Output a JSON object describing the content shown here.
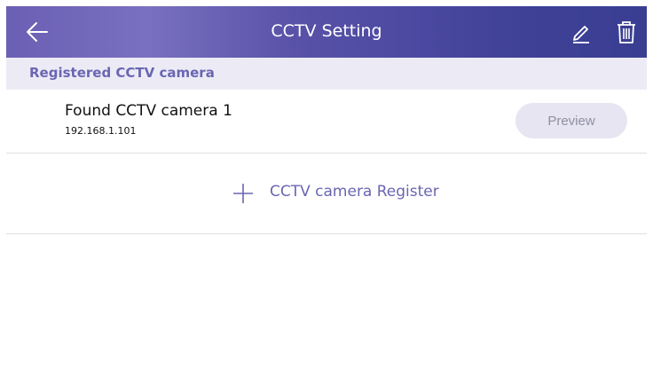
{
  "header": {
    "title": "CCTV Setting",
    "back_icon": "back-arrow-icon",
    "edit_icon": "pencil-icon",
    "delete_icon": "trash-icon"
  },
  "section": {
    "title": "Registered CCTV camera"
  },
  "cameras": [
    {
      "name": "Found CCTV camera 1",
      "ip": "192.168.1.101",
      "preview_label": "Preview"
    }
  ],
  "register": {
    "label": "CCTV camera Register",
    "icon": "plus-icon"
  },
  "colors": {
    "header_gradient_start": "#6a5fb4",
    "header_gradient_end": "#3a3e92",
    "accent": "#6a66b2",
    "section_bg": "#ecebf5",
    "button_bg": "#e6e5f1"
  }
}
